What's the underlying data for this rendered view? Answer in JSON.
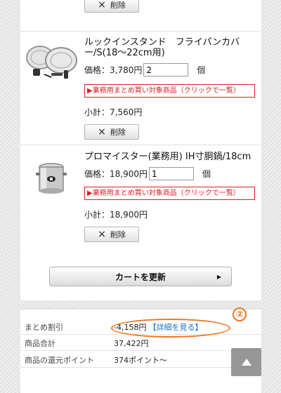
{
  "cart": {
    "delete_label": "削除",
    "delete_icon": "×",
    "items": [
      {
        "title": "ルックインスタンド　フライパンカバー/S(18〜22cm用)",
        "price_label": "価格：3,780円",
        "qty": "2",
        "qty_unit": "個",
        "bulk_link": "▶業務用まとめ買い対象商品（クリックで一覧）",
        "subtotal": "小計：7,560円"
      },
      {
        "title": "プロマイスター(業務用) IH寸胴鍋/18cm",
        "price_label": "価格：18,900円",
        "qty": "1",
        "qty_unit": "個",
        "bulk_link": "▶業務用まとめ買い対象商品（クリックで一覧）",
        "subtotal": "小計：18,900円"
      }
    ],
    "update_label": "カートを更新",
    "update_arrow": "▶"
  },
  "summary": {
    "discount_label": "まとめ割引",
    "discount_value": "-4,158円",
    "discount_link": "【詳細を見る】",
    "total_label": "商品合計",
    "total_value": "37,422円",
    "points_label": "商品の還元ポイント",
    "points_value": "374ポイント〜"
  },
  "annotation": {
    "number": "②",
    "color": "#ee7722"
  },
  "colors": {
    "bulk_red": "#d81e1e",
    "link_blue": "#1a6fc2"
  }
}
